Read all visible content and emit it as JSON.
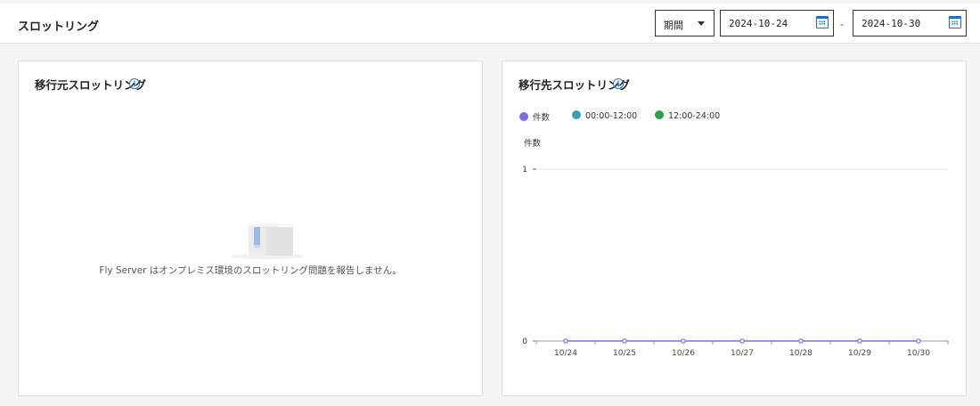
{
  "header": {
    "title": "スロットリング",
    "period_label": "期間",
    "start_date": "2024-10-24",
    "end_date": "2024-10-30",
    "separator": "-"
  },
  "source_panel": {
    "title": "移行元スロットリング",
    "empty_message": "Fly Server はオンプレミス環境のスロットリング問題を報告しません。"
  },
  "target_panel": {
    "title": "移行先スロットリング",
    "legend": [
      {
        "name": "件数",
        "color": "#7b6ee8"
      },
      {
        "name": "00:00-12:00",
        "color": "#3a9fb5"
      },
      {
        "name": "12:00-24:00",
        "color": "#2ea24a"
      }
    ]
  },
  "chart_data": {
    "type": "line",
    "title": "",
    "xlabel": "",
    "ylabel": "件数",
    "categories": [
      "10/24",
      "10/25",
      "10/26",
      "10/27",
      "10/28",
      "10/29",
      "10/30"
    ],
    "series": [
      {
        "name": "件数",
        "values": [
          0,
          0,
          0,
          0,
          0,
          0,
          0
        ],
        "color": "#7b6ee8"
      }
    ],
    "yticks": [
      0,
      1
    ],
    "ylim": [
      0,
      1
    ],
    "grid": true,
    "legend_position": "top-left"
  },
  "icons": {
    "info": "info-icon",
    "calendar": "calendar-icon",
    "dropdown": "chevron-down-icon"
  }
}
